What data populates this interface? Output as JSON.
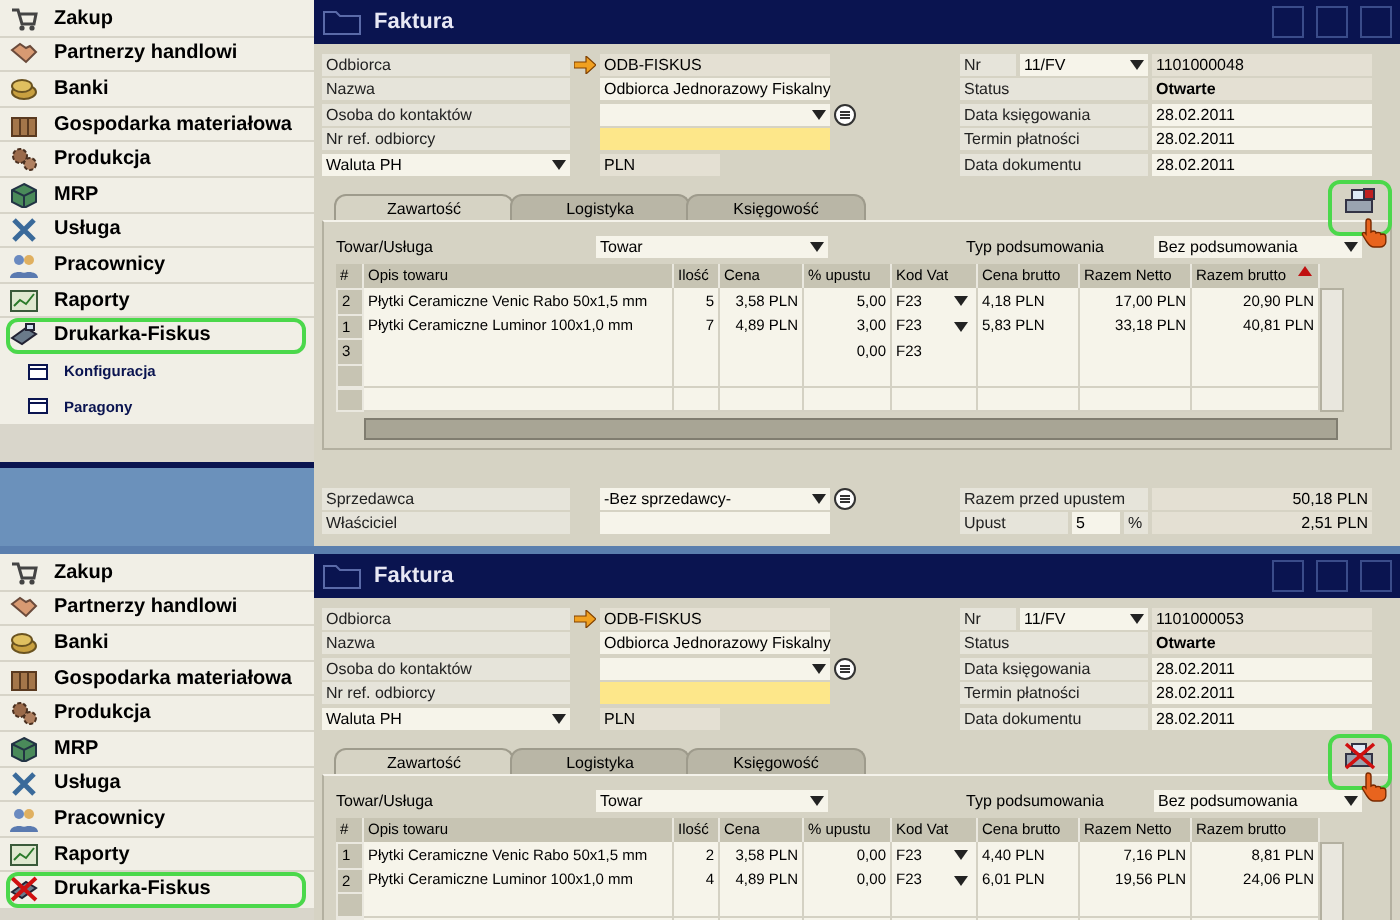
{
  "panels": [
    {
      "sidebar": {
        "items": [
          {
            "label": "Zakup",
            "kind": "cart",
            "highlighted": false
          },
          {
            "label": "Partnerzy handlowi",
            "kind": "handshake",
            "highlighted": false
          },
          {
            "label": "Banki",
            "kind": "coins",
            "highlighted": false
          },
          {
            "label": "Gospodarka materiałowa",
            "kind": "box",
            "highlighted": false
          },
          {
            "label": "Produkcja",
            "kind": "gears",
            "highlighted": false
          },
          {
            "label": "MRP",
            "kind": "cube",
            "highlighted": false
          },
          {
            "label": "Usługa",
            "kind": "tools",
            "highlighted": false
          },
          {
            "label": "Pracownicy",
            "kind": "people",
            "highlighted": false
          },
          {
            "label": "Raporty",
            "kind": "chart",
            "highlighted": false
          },
          {
            "label": "Drukarka-Fiskus",
            "kind": "printer",
            "highlighted": true,
            "children": [
              {
                "label": "Konfiguracja"
              },
              {
                "label": "Paragony"
              }
            ]
          }
        ]
      },
      "window": {
        "title": "Faktura",
        "left_fields": [
          {
            "label": "Odbiorca",
            "value": "ODB-FISKUS",
            "kind": "link"
          },
          {
            "label": "Nazwa",
            "value": "Odbiorca Jednorazowy Fiskalny",
            "kind": "text"
          },
          {
            "label": "Osoba do kontaktów",
            "kind": "choose"
          },
          {
            "label": "Nr ref. odbiorcy",
            "kind": "required"
          }
        ],
        "currency": {
          "label": "Waluta PH",
          "value": "PLN"
        },
        "right_fields": [
          {
            "label": "Nr",
            "series": "11/FV",
            "value": "1101000048"
          },
          {
            "label": "Status",
            "value": "Otwarte"
          },
          {
            "label": "Data księgowania",
            "value": "28.02.2011"
          },
          {
            "label": "Termin płatności",
            "value": "28.02.2011"
          },
          {
            "label": "Data dokumentu",
            "value": "28.02.2011"
          }
        ],
        "tabs": [
          {
            "label": "Zawartość",
            "selected": true
          },
          {
            "label": "Logistyka",
            "selected": false
          },
          {
            "label": "Księgowość",
            "selected": false
          }
        ],
        "fiscal_button": {
          "kind": "printer",
          "highlighted": true
        },
        "item_type": {
          "label": "Towar/Usługa",
          "value": "Towar"
        },
        "summary_type": {
          "label": "Typ podsumowania",
          "value": "Bez podsumowania"
        },
        "table": {
          "columns": [
            {
              "label": "#",
              "sorted": false
            },
            {
              "label": "Opis towaru",
              "sorted": false
            },
            {
              "label": "Ilość",
              "sorted": false
            },
            {
              "label": "Cena",
              "sorted": false
            },
            {
              "label": "% upustu",
              "sorted": false
            },
            {
              "label": "Kod Vat",
              "sorted": false
            },
            {
              "label": "Cena brutto",
              "sorted": false
            },
            {
              "label": "Razem Netto",
              "sorted": false
            },
            {
              "label": "Razem brutto",
              "sorted": true
            }
          ],
          "rows": [
            {
              "no": "2",
              "item": "Płytki Ceramiczne Venic Rabo  50x1,5 mm",
              "qty": "5",
              "price": "3,58 PLN",
              "discount": "5,00",
              "vat": "F23",
              "gross_price": "4,18 PLN",
              "net_total": "17,00 PLN",
              "gross_total": "20,90 PLN"
            },
            {
              "no": "1",
              "item": "Płytki Ceramiczne Luminor  100x1,0 mm",
              "qty": "7",
              "price": "4,89 PLN",
              "discount": "3,00",
              "vat": "F23",
              "gross_price": "5,83 PLN",
              "net_total": "33,18 PLN",
              "gross_total": "40,81 PLN"
            },
            {
              "no": "3",
              "discount": "0,00",
              "vat": "F23"
            }
          ]
        },
        "footer": {
          "seller": {
            "label": "Sprzedawca",
            "value": "-Bez sprzedawcy-"
          },
          "owner": {
            "label": "Właściciel"
          },
          "before_discount": {
            "label": "Razem przed upustem",
            "value": "50,18 PLN"
          },
          "discount": {
            "label": "Upust",
            "percent": "5",
            "unit": "%",
            "value": "2,51 PLN"
          }
        }
      }
    },
    {
      "sidebar": {
        "items": [
          {
            "label": "Zakup",
            "kind": "cart",
            "highlighted": false
          },
          {
            "label": "Partnerzy handlowi",
            "kind": "handshake",
            "highlighted": false
          },
          {
            "label": "Banki",
            "kind": "coins",
            "highlighted": false
          },
          {
            "label": "Gospodarka materiałowa",
            "kind": "box",
            "highlighted": false
          },
          {
            "label": "Produkcja",
            "kind": "gears",
            "highlighted": false
          },
          {
            "label": "MRP",
            "kind": "cube",
            "highlighted": false
          },
          {
            "label": "Usługa",
            "kind": "tools",
            "highlighted": false
          },
          {
            "label": "Pracownicy",
            "kind": "people",
            "highlighted": false
          },
          {
            "label": "Raporty",
            "kind": "chart",
            "highlighted": false
          },
          {
            "label": "Drukarka-Fiskus",
            "kind": "printer_off",
            "highlighted": true
          }
        ]
      },
      "window": {
        "title": "Faktura",
        "left_fields": [
          {
            "label": "Odbiorca",
            "value": "ODB-FISKUS",
            "kind": "link"
          },
          {
            "label": "Nazwa",
            "value": "Odbiorca Jednorazowy Fiskalny",
            "kind": "text"
          },
          {
            "label": "Osoba do kontaktów",
            "kind": "choose"
          },
          {
            "label": "Nr ref. odbiorcy",
            "kind": "required"
          }
        ],
        "currency": {
          "label": "Waluta PH",
          "value": "PLN"
        },
        "right_fields": [
          {
            "label": "Nr",
            "series": "11/FV",
            "value": "1101000053"
          },
          {
            "label": "Status",
            "value": "Otwarte"
          },
          {
            "label": "Data księgowania",
            "value": "28.02.2011"
          },
          {
            "label": "Termin płatności",
            "value": "28.02.2011"
          },
          {
            "label": "Data dokumentu",
            "value": "28.02.2011"
          }
        ],
        "tabs": [
          {
            "label": "Zawartość",
            "selected": true
          },
          {
            "label": "Logistyka",
            "selected": false
          },
          {
            "label": "Księgowość",
            "selected": false
          }
        ],
        "fiscal_button": {
          "kind": "printer_off",
          "highlighted": true
        },
        "item_type": {
          "label": "Towar/Usługa",
          "value": "Towar"
        },
        "summary_type": {
          "label": "Typ podsumowania",
          "value": "Bez podsumowania"
        },
        "table": {
          "columns": [
            {
              "label": "#",
              "sorted": false
            },
            {
              "label": "Opis towaru",
              "sorted": false
            },
            {
              "label": "Ilość",
              "sorted": false
            },
            {
              "label": "Cena",
              "sorted": false
            },
            {
              "label": "% upustu",
              "sorted": false
            },
            {
              "label": "Kod Vat",
              "sorted": false
            },
            {
              "label": "Cena brutto",
              "sorted": false
            },
            {
              "label": "Razem Netto",
              "sorted": false
            },
            {
              "label": "Razem brutto",
              "sorted": false
            }
          ],
          "rows": [
            {
              "no": "1",
              "item": "Płytki Ceramiczne Venic Rabo  50x1,5 mm",
              "qty": "2",
              "price": "3,58 PLN",
              "discount": "0,00",
              "vat": "F23",
              "gross_price": "4,40 PLN",
              "net_total": "7,16 PLN",
              "gross_total": "8,81 PLN"
            },
            {
              "no": "2",
              "item": "Płytki Ceramiczne Luminor  100x1,0 mm",
              "qty": "4",
              "price": "4,89 PLN",
              "discount": "0,00",
              "vat": "F23",
              "gross_price": "6,01 PLN",
              "net_total": "19,56 PLN",
              "gross_total": "24,06 PLN"
            }
          ]
        }
      }
    }
  ]
}
